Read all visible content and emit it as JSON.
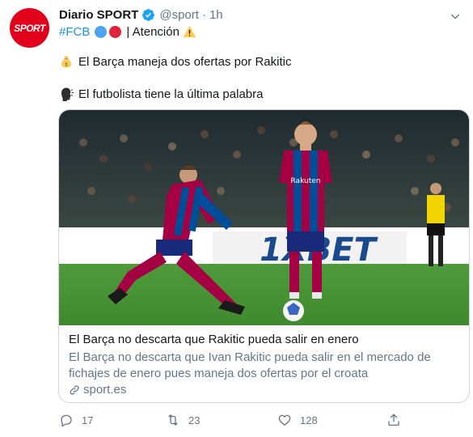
{
  "tweet": {
    "avatar_text": "SPORT",
    "author_name": "Diario SPORT",
    "handle": "@sport",
    "separator": "·",
    "time": "1h",
    "hashtag": "#FCB",
    "line1_suffix": "| Atención",
    "line2_text": "El Barça maneja dos ofertas por Rakitic",
    "line3_text": "El futbolista tiene la última palabra"
  },
  "card": {
    "title": "El Barça no descarta que Rakitic pueda salir en enero",
    "description": "El Barça no descarta que Ivan Rakitic pueda salir en el mercado de fichajes de enero pues maneja dos ofertas por el croata",
    "domain": "sport.es",
    "image_shirt_text": "Rakuten",
    "image_board_text": "1XBET"
  },
  "actions": {
    "replies": "17",
    "retweets": "23",
    "likes": "128"
  },
  "icons": [
    "verified-icon",
    "caret-down-icon",
    "warning-icon",
    "money-bag-icon",
    "speaking-head-icon",
    "link-icon",
    "reply-icon",
    "retweet-icon",
    "like-icon",
    "share-icon"
  ],
  "colors": {
    "accent": "#1b95e0",
    "secondary_text": "#657786",
    "brand_red": "#e2001a",
    "border": "#ccd6dd"
  }
}
